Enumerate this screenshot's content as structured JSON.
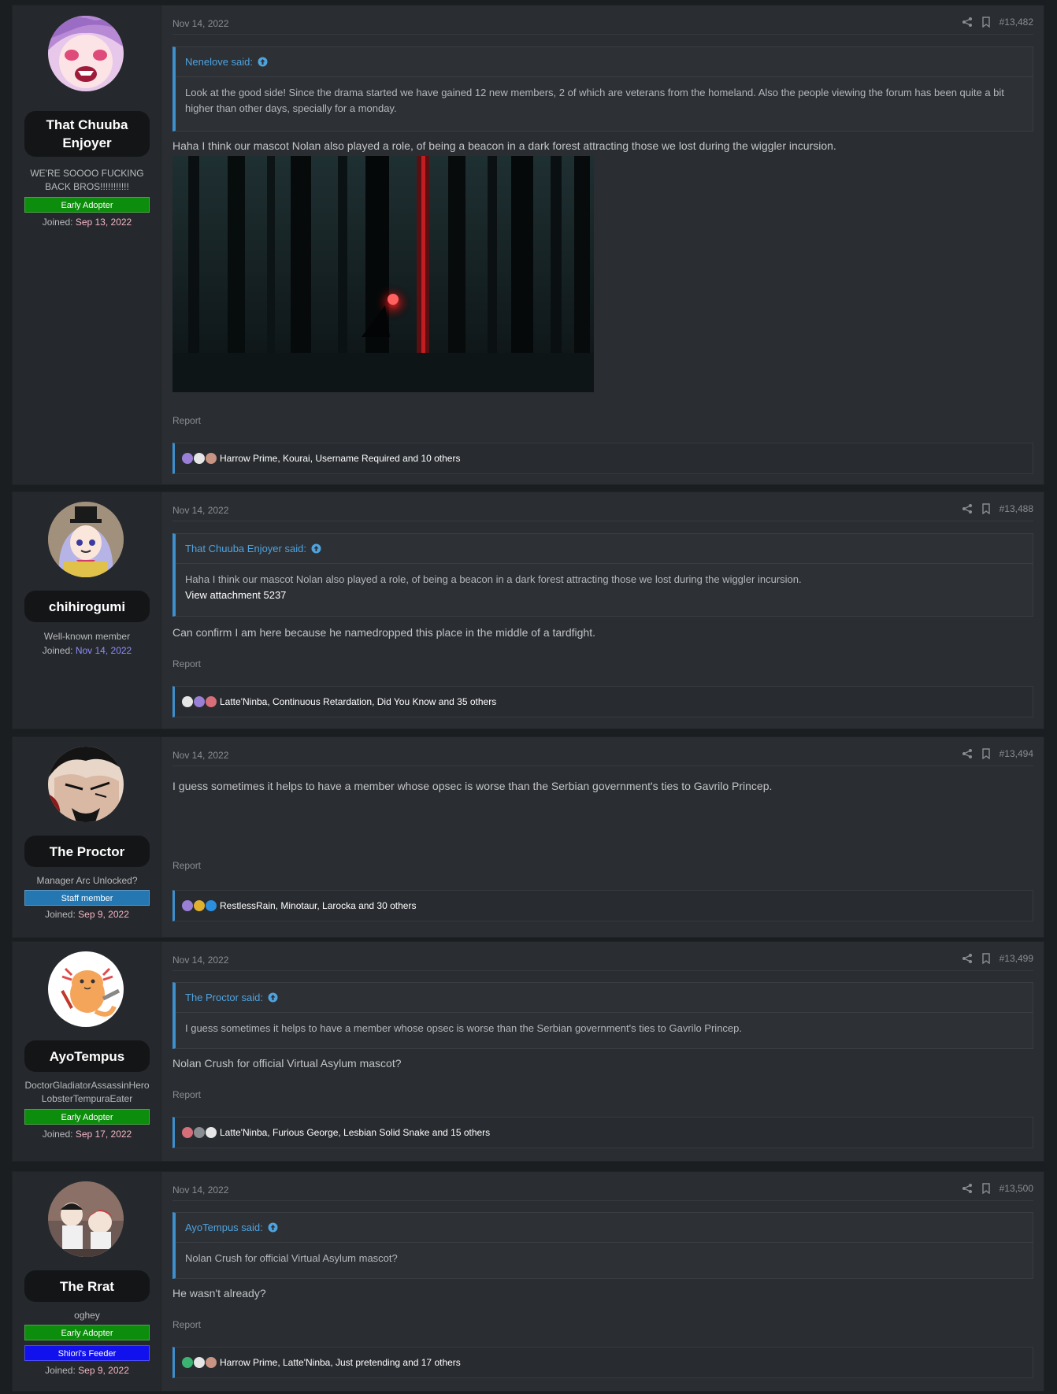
{
  "colors": {
    "page_bg": "#1b1e21",
    "post_bg": "#2a2d31",
    "user_col_bg": "#25282c",
    "link_blue": "#4fa3de",
    "quote_border": "#3d8fce",
    "banner_green": "#0c8d0c",
    "banner_staff": "#2577b1",
    "banner_blue": "#1111ee",
    "joined_date_pink": "#f5b7c5",
    "joined_date_purple": "#8e8efa"
  },
  "posts": [
    {
      "username": "That Chuuba Enjoyer",
      "user_title": "WE'RE SOOOO FUCKING BACK BROS!!!!!!!!!!!",
      "banners": [
        "Early Adopter"
      ],
      "joined_label": "Joined:",
      "joined_date": "Sep 13, 2022",
      "date": "Nov 14, 2022",
      "post_number": "#13,482",
      "quote": {
        "author": "Nenelove said:",
        "text": "Look at the good side! Since the drama started we have gained 12 new members, 2 of which are veterans from the homeland. Also the people viewing the forum has been quite a bit higher than other days, specially for a monday."
      },
      "message": "Haha I think our mascot Nolan also played a role, of being a beacon in a dark forest attracting those we lost during the wiggler incursion.",
      "report": "Report",
      "reactions": "Harrow Prime, Kourai, Username Required and 10 others",
      "avatar_icon": "anime-avatar"
    },
    {
      "username": "chihirogumi",
      "user_title": "Well-known member",
      "banners": [],
      "joined_label": "Joined:",
      "joined_date": "Nov 14, 2022",
      "date": "Nov 14, 2022",
      "post_number": "#13,488",
      "quote": {
        "author": "That Chuuba Enjoyer said:",
        "text": "Haha I think our mascot Nolan also played a role, of being a beacon in a dark forest attracting those we lost during the wiggler incursion.",
        "attachment": "View attachment 5237"
      },
      "message": "Can confirm I am here because he namedropped this place in the middle of a tardfight.",
      "report": "Report",
      "reactions": "Latte'Ninba, Continuous Retardation, Did You Know and 35 others",
      "avatar_icon": "anime-avatar"
    },
    {
      "username": "The Proctor",
      "user_title": "Manager Arc Unlocked?",
      "banners": [
        "Staff member"
      ],
      "joined_label": "Joined:",
      "joined_date": "Sep 9, 2022",
      "date": "Nov 14, 2022",
      "post_number": "#13,494",
      "message": "I guess sometimes it helps to have a member whose opsec is worse than the Serbian government's ties to Gavrilo Princep.",
      "report": "Report",
      "reactions": "RestlessRain, Minotaur, Larocka and 30 others",
      "avatar_icon": "anime-avatar"
    },
    {
      "username": "AyoTempus",
      "user_title": "DoctorGladiatorAssassinHero LobsterTempuraEater",
      "banners": [
        "Early Adopter"
      ],
      "joined_label": "Joined:",
      "joined_date": "Sep 17, 2022",
      "date": "Nov 14, 2022",
      "post_number": "#13,499",
      "quote": {
        "author": "The Proctor said:",
        "text": "I guess sometimes it helps to have a member whose opsec is worse than the Serbian government's ties to Gavrilo Princep."
      },
      "message": "Nolan Crush for official Virtual Asylum mascot?",
      "report": "Report",
      "reactions": "Latte'Ninba, Furious George, Lesbian Solid Snake and 15 others",
      "avatar_icon": "axolotl-avatar"
    },
    {
      "username": "The Rrat",
      "user_title": "oghey",
      "banners": [
        "Early Adopter",
        "Shiori's Feeder"
      ],
      "joined_label": "Joined:",
      "joined_date": "Sep 9, 2022",
      "date": "Nov 14, 2022",
      "post_number": "#13,500",
      "quote": {
        "author": "AyoTempus said:",
        "text": "Nolan Crush for official Virtual Asylum mascot?"
      },
      "message": "He wasn't already?",
      "report": "Report",
      "reactions": "Harrow Prime, Latte'Ninba, Just pretending and 17 others",
      "avatar_icon": "anime-avatar"
    }
  ]
}
